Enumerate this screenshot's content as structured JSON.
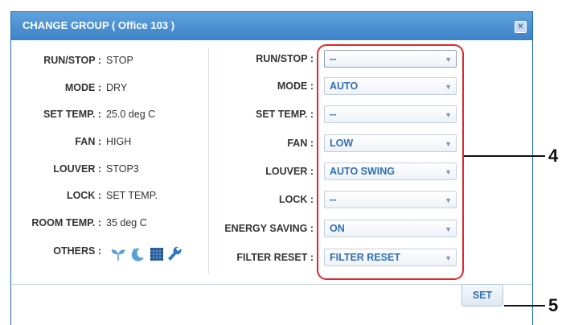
{
  "dialog": {
    "title": "CHANGE GROUP ( Office 103 )",
    "close_symbol": "×"
  },
  "status": [
    {
      "label": "RUN/STOP :",
      "value": "STOP"
    },
    {
      "label": "MODE :",
      "value": "DRY"
    },
    {
      "label": "SET TEMP. :",
      "value": "25.0 deg C"
    },
    {
      "label": "FAN :",
      "value": "HIGH"
    },
    {
      "label": "LOUVER :",
      "value": "STOP3"
    },
    {
      "label": "LOCK :",
      "value": "SET TEMP."
    },
    {
      "label": "ROOM TEMP. :",
      "value": "35 deg C"
    },
    {
      "label": "OTHERS :",
      "value": ""
    }
  ],
  "others_icons": [
    "energy-saving-leaf-icon",
    "night-moon-icon",
    "schedule-grid-icon",
    "filter-wrench-icon"
  ],
  "settings": [
    {
      "label": "RUN/STOP :",
      "value": "--"
    },
    {
      "label": "MODE :",
      "value": "AUTO"
    },
    {
      "label": "SET TEMP. :",
      "value": "--"
    },
    {
      "label": "FAN :",
      "value": "LOW"
    },
    {
      "label": "LOUVER :",
      "value": "AUTO SWING"
    },
    {
      "label": "LOCK :",
      "value": "--"
    },
    {
      "label": "ENERGY SAVING :",
      "value": "ON"
    },
    {
      "label": "FILTER RESET :",
      "value": "FILTER RESET"
    }
  ],
  "set_button": "SET",
  "callouts": {
    "selects": "4",
    "set": "5"
  },
  "colors": {
    "title_bar": "#3b82c8",
    "accent_text": "#2f6fb5",
    "highlight": "#e3262d"
  }
}
